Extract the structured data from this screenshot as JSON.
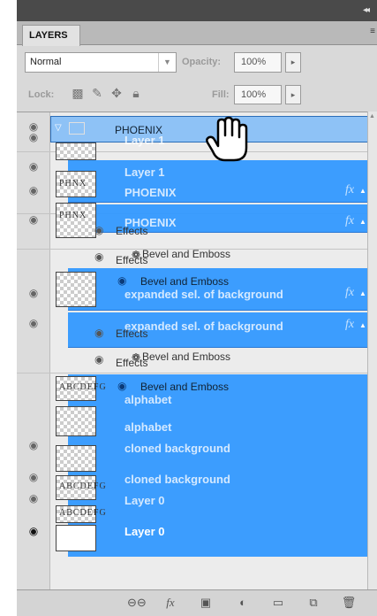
{
  "panel": {
    "collapse_glyph": "◂◂",
    "tab_label": "LAYERS",
    "menu_glyph": "≡"
  },
  "controls": {
    "blend_mode": "Normal",
    "opacity_label": "Opacity:",
    "opacity_value": "100%",
    "lock_label": "Lock:",
    "fill_label": "Fill:",
    "fill_value": "100%"
  },
  "layers": {
    "phoenix_group": "PHOENIX",
    "layer1_a": "Layer 1",
    "layer1_b": "Layer 1",
    "phoenix_a": "PHOENIX",
    "phoenix_b": "PHOENIX",
    "expanded_a": "expanded sel. of background",
    "expanded_b": "expanded sel. of background",
    "alphabet_a": "alphabet",
    "alphabet_b": "alphabet",
    "cloned_a": "cloned background",
    "cloned_b": "cloned background",
    "layer0_a": "Layer 0",
    "layer0_b": "Layer 0",
    "thumb_phoenix_text": "PHNX",
    "thumb_alpha_text": "ABCDEFG"
  },
  "effects": {
    "effects_label": "Effects",
    "bevel_label": "Bevel and Emboss",
    "fx_label": "fx"
  },
  "icons": {
    "eye": "eye-icon",
    "hand_cursor": "hand-cursor-icon",
    "link": "link-layers-icon",
    "fx": "add-layer-style-icon",
    "mask": "add-mask-icon",
    "adjustment": "adjustment-layer-icon",
    "group": "new-group-icon",
    "new_layer": "new-layer-icon",
    "trash": "delete-layer-icon"
  },
  "colors": {
    "selection": "#3399ff",
    "panel_bg": "#d9d9d9",
    "title_bar": "#4a4a4a"
  }
}
